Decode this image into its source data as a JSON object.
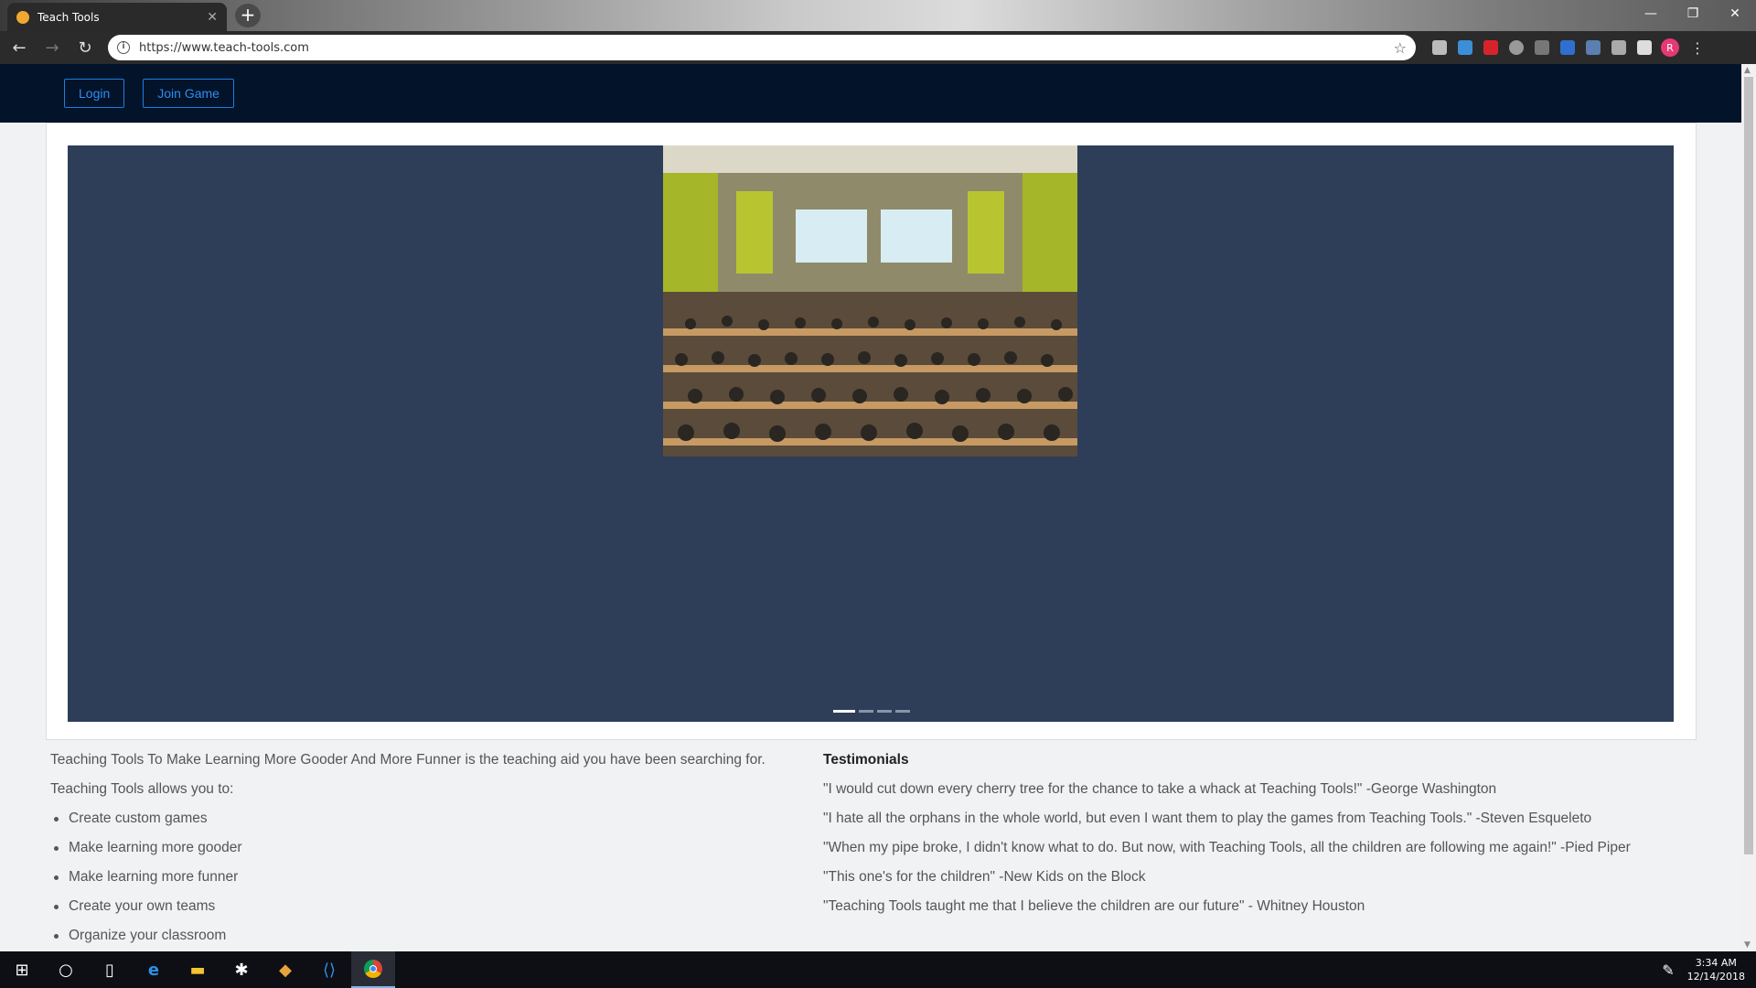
{
  "browser": {
    "tab_title": "Teach Tools",
    "url": "https://www.teach-tools.com",
    "profile_initial": "R"
  },
  "nav": {
    "login_label": "Login",
    "join_game_label": "Join Game"
  },
  "carousel": {
    "slide_count": 4,
    "active_slide": 1,
    "background_color": "#2e3e58"
  },
  "about": {
    "intro": "Teaching Tools To Make Learning More Gooder And More Funner is the teaching aid you have been searching for.",
    "allows_heading": "Teaching Tools allows you to:",
    "features": [
      "Create custom games",
      "Make learning more gooder",
      "Make learning more funner",
      "Create your own teams",
      "Organize your classroom"
    ]
  },
  "testimonials": {
    "title": "Testimonials",
    "items": [
      "\"I would cut down every cherry tree for the chance to take a whack at Teaching Tools!\" -George Washington",
      "\"I hate all the orphans in the whole world, but even I want them to play the games from Teaching Tools.\" -Steven Esqueleto",
      "\"When my pipe broke, I didn't know what to do. But now, with Teaching Tools, all the children are following me again!\" -Pied Piper",
      "\"This one's for the children\" -New Kids on the Block",
      "\"Teaching Tools taught me that I believe the children are our future\" - Whitney Houston"
    ]
  },
  "taskbar": {
    "time": "3:34 AM",
    "date": "12/14/2018"
  },
  "colors": {
    "navbar": "#02132a",
    "accent": "#1e7de0"
  }
}
